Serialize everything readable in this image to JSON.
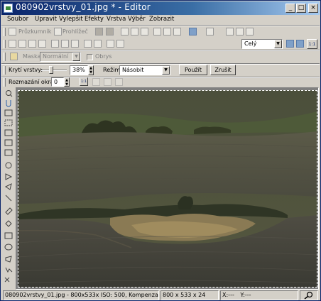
{
  "window": {
    "title": "080902vrstvy_01.jpg * - Editor",
    "minimize_glyph": "_",
    "maximize_glyph": "□",
    "close_glyph": "×"
  },
  "menu": {
    "items": [
      "Soubor",
      "Upravit",
      "Vylepšit",
      "Efekty",
      "Vrstva",
      "Výběr",
      "Zobrazit"
    ]
  },
  "toolbar_main": {
    "browser_label": "Průzkumník",
    "viewer_label": "Prohlížeč",
    "zoom_value": "Celý",
    "zoom_1to1_label": "1:1"
  },
  "toolbar_mask": {
    "mask_label": "Maska:",
    "mask_value": "Normální",
    "outline_label": "Obrys"
  },
  "toolbar_layer": {
    "opacity_label": "Krytí vrstvy:",
    "opacity_value": "38%",
    "opacity_level": 0.38,
    "mode_label": "Režim:",
    "mode_value": "Násobit",
    "apply_label": "Použít",
    "cancel_label": "Zrušit"
  },
  "toolbar_feather": {
    "feather_label": "Rozmazání okrajů:",
    "feather_value": "0",
    "feather_1to1_label": "1:1"
  },
  "status": {
    "file_info": "080902vrstvy_01.jpg - 800x533x ISO: 500, Kompenzac...",
    "dimensions": "800 x 533 x 24",
    "cursor_x": "X:---",
    "cursor_y": "Y:---"
  },
  "colors": {
    "title_start": "#0a246a",
    "title_end": "#a6caf0",
    "chrome": "#d4d0c8",
    "accent_blue": "#3a6ea5"
  }
}
